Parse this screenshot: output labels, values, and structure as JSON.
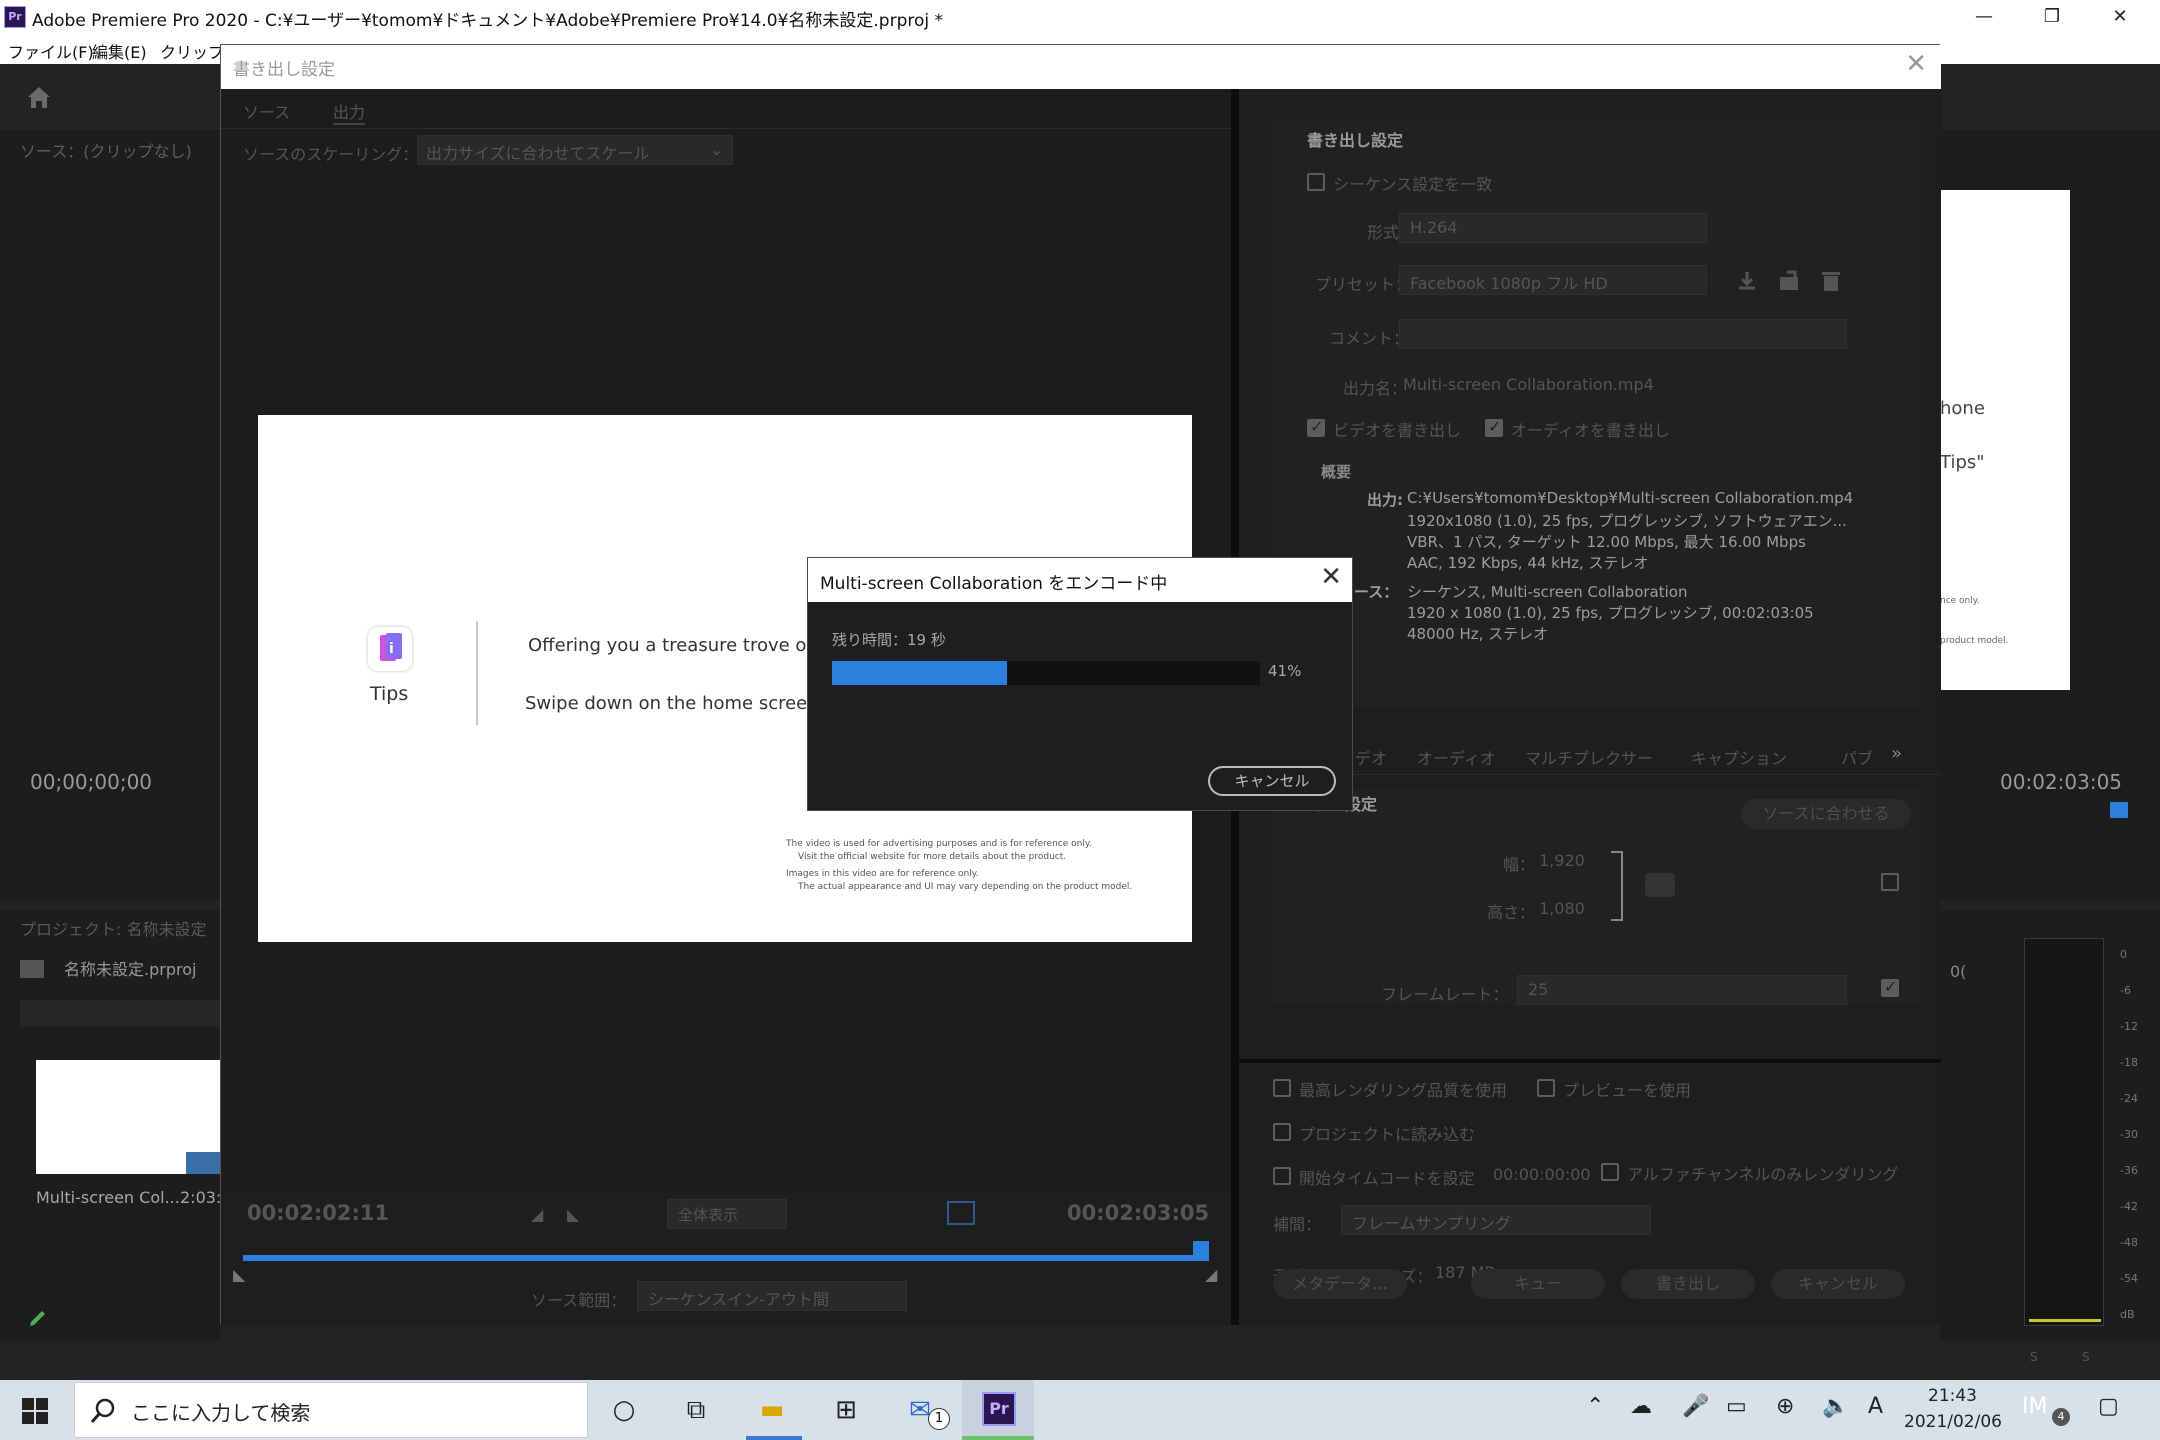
{
  "window": {
    "app_icon": "Pr",
    "title": "Adobe Premiere Pro 2020 - C:¥ユーザー¥tomom¥ドキュメント¥Adobe¥Premiere Pro¥14.0¥名称未設定.prproj *",
    "minimize": "—",
    "restore": "❐",
    "close": "✕"
  },
  "menu": [
    "ファイル(F)",
    "編集(E)",
    "クリップ(C"
  ],
  "background": {
    "source_label": "ソース：(クリップなし)",
    "timecode_left": "00;00;00;00",
    "project_label": "プロジェクト: 名称未設定",
    "project_file": "名称未設定.prproj",
    "clip_name": "Multi-screen Col...",
    "clip_duration": "2:03:",
    "timecode_right": "00:02:03:05",
    "peek_text_1": "hone",
    "peek_text_2": "Tips\"",
    "peek_text_3": "nce only.",
    "peek_text_4": "product model.",
    "peek_text_5": "0(",
    "meter_ticks": [
      "0",
      "-6",
      "-12",
      "-18",
      "-24",
      "-30",
      "-36",
      "-42",
      "-48",
      "-54",
      "dB"
    ],
    "meter_solo": [
      "S",
      "S"
    ]
  },
  "export_dialog": {
    "title": "書き出し設定",
    "close": "✕",
    "tabs": [
      "ソース",
      "出力"
    ],
    "scaling_label": "ソースのスケーリング：",
    "scaling_value": "出力サイズに合わせてスケール",
    "preview": {
      "logo_label": "Tips",
      "line1": "Offering you a treasure trove of v",
      "line2": "Swipe down on the home screen",
      "note1a": "The video is used for advertising purposes and is for reference only.",
      "note1b": "Visit the official website for more details about the product.",
      "note2a": "Images in this video are for reference only.",
      "note2b": "The actual appearance and UI may vary depending on the product model."
    },
    "timecode_in": "00:02:02:11",
    "zoom_value": "全体表示",
    "timecode_out": "00:02:03:05",
    "range_label": "ソース範囲：",
    "range_value": "シーケンスイン-アウト間",
    "settings": {
      "header": "書き出し設定",
      "match_sequence": "シーケンス設定を一致",
      "format_label": "形式：",
      "format_value": "H.264",
      "preset_label": "プリセット：",
      "preset_value": "Facebook 1080p フル HD",
      "comment_label": "コメント：",
      "output_name_label": "出力名：",
      "output_name_value": "Multi-screen Collaboration.mp4",
      "export_video": "ビデオを書き出し",
      "export_audio": "オーディオを書き出し",
      "summary_header": "概要",
      "out_label": "出力:",
      "out_lines": [
        "C:¥Users¥tomom¥Desktop¥Multi-screen Collaboration.mp4",
        "1920x1080 (1.0), 25 fps, プログレッシブ, ソフトウェアエン...",
        "VBR、1 パス, ターゲット 12.00 Mbps, 最大 16.00 Mbps",
        "AAC, 192 Kbps, 44 kHz, ステレオ"
      ],
      "src_label": "ソース：",
      "src_lines": [
        "シーケンス, Multi-screen Collaboration",
        "1920 x 1080 (1.0), 25 fps, プログレッシブ, 00:02:03:05",
        "48000  Hz, ステレオ"
      ],
      "tabs2": [
        "ビデオ",
        "オーディオ",
        "マルチプレクサー",
        "キャプション",
        "パブ"
      ],
      "video_settings_header": "デオ設定",
      "match_source": "ソースに合わせる",
      "width_label": "幅：",
      "width_value": "1,920",
      "height_label": "高さ：",
      "height_value": "1,080",
      "framerate_label": "フレームレート：",
      "framerate_value": "25",
      "max_quality": "最高レンダリング品質を使用",
      "use_preview": "プレビューを使用",
      "import_project": "プロジェクトに読み込む",
      "start_timecode": "開始タイムコードを設定",
      "start_timecode_value": "00:00:00:00",
      "alpha_only": "アルファチャンネルのみレンダリング",
      "interp_label": "補間：",
      "interp_value": "フレームサンプリング",
      "filesize_label": "予測ファイルサイズ：",
      "filesize_value": "187 MB",
      "btn_metadata": "メタデータ...",
      "btn_queue": "キュー",
      "btn_export": "書き出し",
      "btn_cancel": "キャンセル"
    }
  },
  "encode_dialog": {
    "title": "Multi-screen Collaboration をエンコード中",
    "close": "✕",
    "remaining": "残り時間：19 秒",
    "progress": 0.41,
    "progress_text": "41%",
    "cancel": "キャンセル"
  },
  "taskbar": {
    "search_placeholder": "ここに入力して検索",
    "mail_badge": "1",
    "time": "21:43",
    "date": "2021/02/06",
    "ime": "A",
    "notif_badge": "4"
  }
}
